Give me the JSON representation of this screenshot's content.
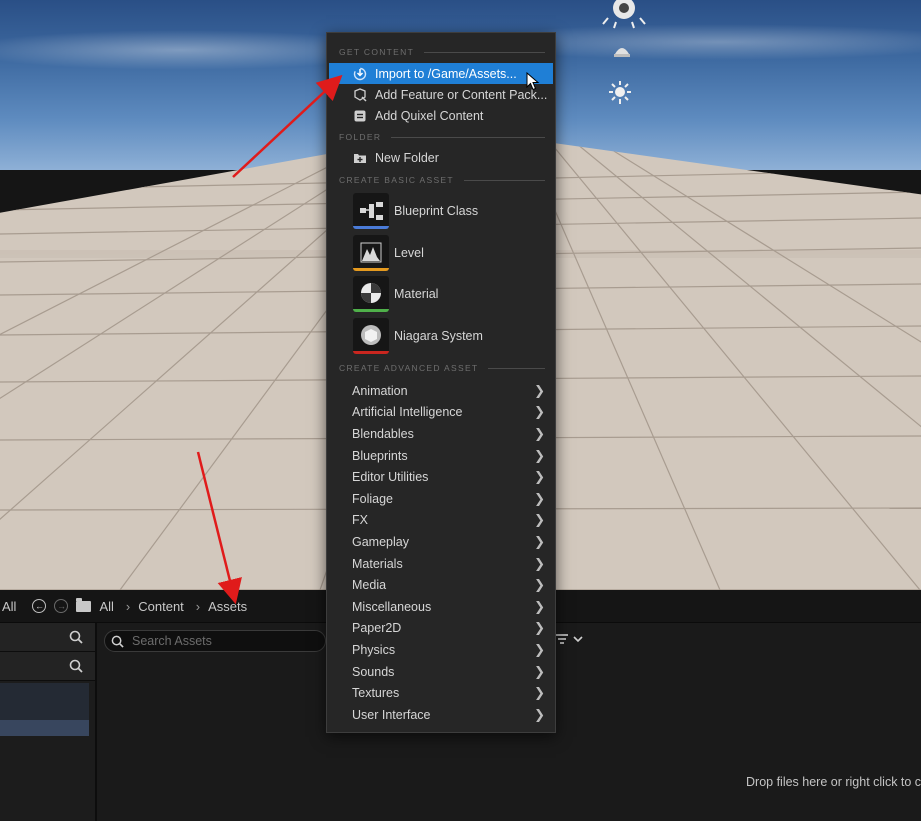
{
  "context_menu": {
    "sections": {
      "get_content": "GET CONTENT",
      "folder": "FOLDER",
      "create_basic_asset": "CREATE BASIC ASSET",
      "create_advanced_asset": "CREATE ADVANCED ASSET"
    },
    "get_content_items": [
      {
        "label": "Import to /Game/Assets...",
        "icon": "import-icon",
        "highlighted": true
      },
      {
        "label": "Add Feature or Content Pack...",
        "icon": "feature-pack-icon"
      },
      {
        "label": "Add Quixel Content",
        "icon": "quixel-icon"
      }
    ],
    "folder_items": [
      {
        "label": "New Folder",
        "icon": "new-folder-icon"
      }
    ],
    "basic_assets": [
      {
        "label": "Blueprint Class",
        "icon": "blueprint-class-icon",
        "color": "#4a7bd8"
      },
      {
        "label": "Level",
        "icon": "level-icon",
        "color": "#e59a1f"
      },
      {
        "label": "Material",
        "icon": "material-icon",
        "color": "#4fb04a"
      },
      {
        "label": "Niagara System",
        "icon": "niagara-system-icon",
        "color": "#c9261f"
      }
    ],
    "advanced_assets": [
      "Animation",
      "Artificial Intelligence",
      "Blendables",
      "Blueprints",
      "Editor Utilities",
      "Foliage",
      "FX",
      "Gameplay",
      "Materials",
      "Media",
      "Miscellaneous",
      "Paper2D",
      "Physics",
      "Sounds",
      "Textures",
      "User Interface"
    ]
  },
  "path_bar": {
    "left_label": "All",
    "crumbs": [
      "All",
      "Content",
      "Assets"
    ]
  },
  "search": {
    "placeholder": "Search Assets"
  },
  "drop_hint": "Drop files here or right click to c",
  "colors": {
    "highlight": "#1f7fd6",
    "annotation_arrow": "#e01b1b"
  }
}
